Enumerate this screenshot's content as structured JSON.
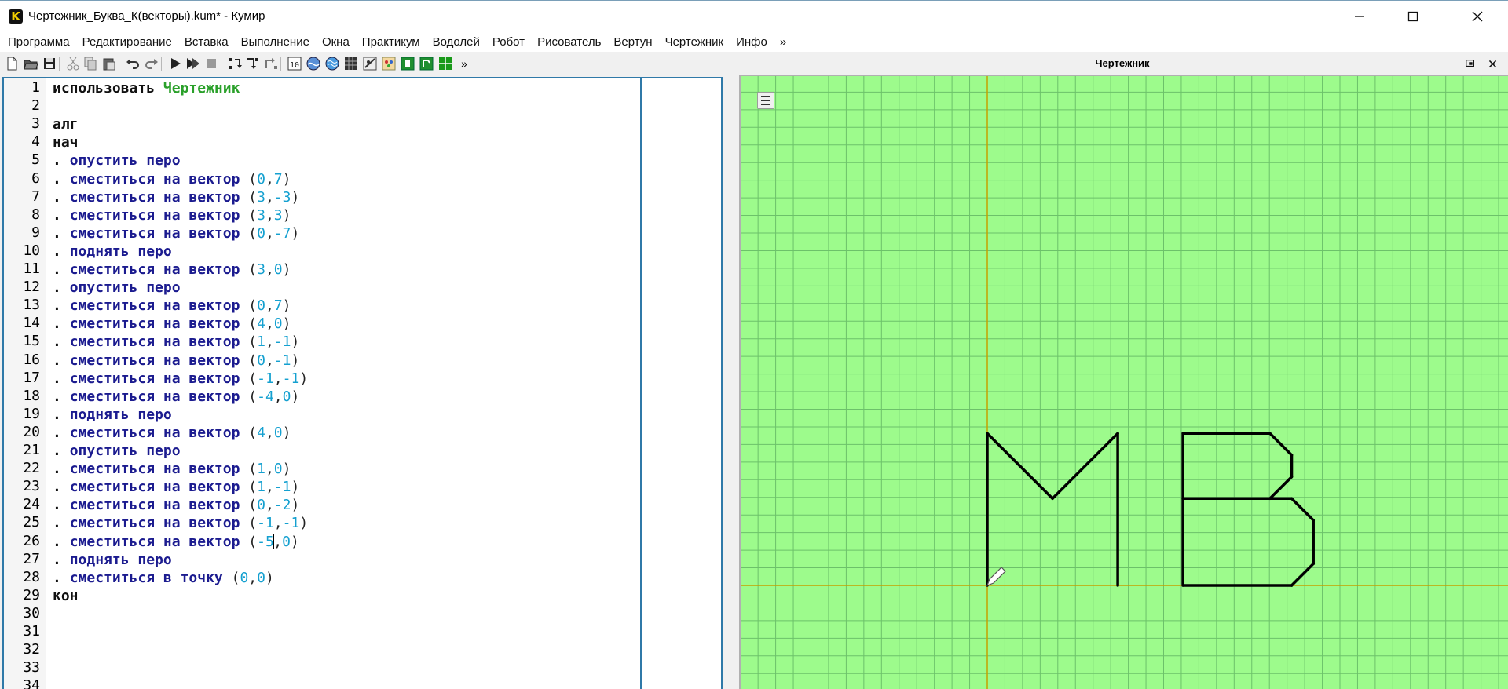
{
  "window": {
    "title": "Чертежник_Буква_К(векторы).kum* - Кумир",
    "app_icon_letter": "K",
    "controls": [
      "minimize-icon",
      "maximize-icon",
      "close-icon"
    ]
  },
  "menu": {
    "items": [
      "Программа",
      "Редактирование",
      "Вставка",
      "Выполнение",
      "Окна",
      "Практикум",
      "Водолей",
      "Робот",
      "Рисователь",
      "Вертун",
      "Чертежник",
      "Инфо",
      "»"
    ]
  },
  "toolbar": {
    "buttons": [
      "new-file-icon",
      "open-folder-icon",
      "save-icon",
      "cut-icon",
      "copy-icon",
      "paste-icon",
      "undo-icon",
      "redo-icon",
      "run-icon",
      "run-steps-icon",
      "stop-icon",
      "step-over-icon",
      "step-into-icon",
      "step-out-icon",
      "counter-icon",
      "water-icon",
      "world-icon",
      "grid-icon",
      "robot-icon",
      "painter-icon",
      "vertun-icon",
      "drawer-icon",
      "grid-green-icon"
    ],
    "overflow_label": "»"
  },
  "editor": {
    "lines": [
      {
        "n": "1",
        "parts": [
          {
            "t": "использовать ",
            "c": "kw-black"
          },
          {
            "t": "Чертежник",
            "c": "kw-green"
          }
        ]
      },
      {
        "n": "2",
        "parts": []
      },
      {
        "n": "3",
        "parts": [
          {
            "t": "алг",
            "c": "kw-black"
          }
        ]
      },
      {
        "n": "4",
        "parts": [
          {
            "t": "нач",
            "c": "kw-black"
          }
        ]
      },
      {
        "n": "5",
        "parts": [
          {
            "t": ". ",
            "c": "kw-black"
          },
          {
            "t": "опустить перо",
            "c": "kw-blue"
          }
        ]
      },
      {
        "n": "6",
        "parts": [
          {
            "t": ". ",
            "c": "kw-black"
          },
          {
            "t": "сместиться на вектор ",
            "c": "kw-blue"
          },
          {
            "t": "(",
            "c": "plain"
          },
          {
            "t": "0",
            "c": "num"
          },
          {
            "t": ",",
            "c": "plain"
          },
          {
            "t": "7",
            "c": "num"
          },
          {
            "t": ")",
            "c": "plain"
          }
        ]
      },
      {
        "n": "7",
        "parts": [
          {
            "t": ". ",
            "c": "kw-black"
          },
          {
            "t": "сместиться на вектор ",
            "c": "kw-blue"
          },
          {
            "t": "(",
            "c": "plain"
          },
          {
            "t": "3",
            "c": "num"
          },
          {
            "t": ",",
            "c": "plain"
          },
          {
            "t": "-3",
            "c": "num"
          },
          {
            "t": ")",
            "c": "plain"
          }
        ]
      },
      {
        "n": "8",
        "parts": [
          {
            "t": ". ",
            "c": "kw-black"
          },
          {
            "t": "сместиться на вектор ",
            "c": "kw-blue"
          },
          {
            "t": "(",
            "c": "plain"
          },
          {
            "t": "3",
            "c": "num"
          },
          {
            "t": ",",
            "c": "plain"
          },
          {
            "t": "3",
            "c": "num"
          },
          {
            "t": ")",
            "c": "plain"
          }
        ]
      },
      {
        "n": "9",
        "parts": [
          {
            "t": ". ",
            "c": "kw-black"
          },
          {
            "t": "сместиться на вектор ",
            "c": "kw-blue"
          },
          {
            "t": "(",
            "c": "plain"
          },
          {
            "t": "0",
            "c": "num"
          },
          {
            "t": ",",
            "c": "plain"
          },
          {
            "t": "-7",
            "c": "num"
          },
          {
            "t": ")",
            "c": "plain"
          }
        ]
      },
      {
        "n": "10",
        "parts": [
          {
            "t": ". ",
            "c": "kw-black"
          },
          {
            "t": "поднять перо",
            "c": "kw-blue"
          }
        ]
      },
      {
        "n": "11",
        "parts": [
          {
            "t": ". ",
            "c": "kw-black"
          },
          {
            "t": "сместиться на вектор ",
            "c": "kw-blue"
          },
          {
            "t": "(",
            "c": "plain"
          },
          {
            "t": "3",
            "c": "num"
          },
          {
            "t": ",",
            "c": "plain"
          },
          {
            "t": "0",
            "c": "num"
          },
          {
            "t": ")",
            "c": "plain"
          }
        ]
      },
      {
        "n": "12",
        "parts": [
          {
            "t": ". ",
            "c": "kw-black"
          },
          {
            "t": "опустить перо",
            "c": "kw-blue"
          }
        ]
      },
      {
        "n": "13",
        "parts": [
          {
            "t": ". ",
            "c": "kw-black"
          },
          {
            "t": "сместиться на вектор ",
            "c": "kw-blue"
          },
          {
            "t": "(",
            "c": "plain"
          },
          {
            "t": "0",
            "c": "num"
          },
          {
            "t": ",",
            "c": "plain"
          },
          {
            "t": "7",
            "c": "num"
          },
          {
            "t": ")",
            "c": "plain"
          }
        ]
      },
      {
        "n": "14",
        "parts": [
          {
            "t": ". ",
            "c": "kw-black"
          },
          {
            "t": "сместиться на вектор ",
            "c": "kw-blue"
          },
          {
            "t": "(",
            "c": "plain"
          },
          {
            "t": "4",
            "c": "num"
          },
          {
            "t": ",",
            "c": "plain"
          },
          {
            "t": "0",
            "c": "num"
          },
          {
            "t": ")",
            "c": "plain"
          }
        ]
      },
      {
        "n": "15",
        "parts": [
          {
            "t": ". ",
            "c": "kw-black"
          },
          {
            "t": "сместиться на вектор ",
            "c": "kw-blue"
          },
          {
            "t": "(",
            "c": "plain"
          },
          {
            "t": "1",
            "c": "num"
          },
          {
            "t": ",",
            "c": "plain"
          },
          {
            "t": "-1",
            "c": "num"
          },
          {
            "t": ")",
            "c": "plain"
          }
        ]
      },
      {
        "n": "16",
        "parts": [
          {
            "t": ". ",
            "c": "kw-black"
          },
          {
            "t": "сместиться на вектор ",
            "c": "kw-blue"
          },
          {
            "t": "(",
            "c": "plain"
          },
          {
            "t": "0",
            "c": "num"
          },
          {
            "t": ",",
            "c": "plain"
          },
          {
            "t": "-1",
            "c": "num"
          },
          {
            "t": ")",
            "c": "plain"
          }
        ]
      },
      {
        "n": "17",
        "parts": [
          {
            "t": ". ",
            "c": "kw-black"
          },
          {
            "t": "сместиться на вектор ",
            "c": "kw-blue"
          },
          {
            "t": "(",
            "c": "plain"
          },
          {
            "t": "-1",
            "c": "num"
          },
          {
            "t": ",",
            "c": "plain"
          },
          {
            "t": "-1",
            "c": "num"
          },
          {
            "t": ")",
            "c": "plain"
          }
        ]
      },
      {
        "n": "18",
        "parts": [
          {
            "t": ". ",
            "c": "kw-black"
          },
          {
            "t": "сместиться на вектор ",
            "c": "kw-blue"
          },
          {
            "t": "(",
            "c": "plain"
          },
          {
            "t": "-4",
            "c": "num"
          },
          {
            "t": ",",
            "c": "plain"
          },
          {
            "t": "0",
            "c": "num"
          },
          {
            "t": ")",
            "c": "plain"
          }
        ]
      },
      {
        "n": "19",
        "parts": [
          {
            "t": ". ",
            "c": "kw-black"
          },
          {
            "t": "поднять перо",
            "c": "kw-blue"
          }
        ]
      },
      {
        "n": "20",
        "parts": [
          {
            "t": ". ",
            "c": "kw-black"
          },
          {
            "t": "сместиться на вектор ",
            "c": "kw-blue"
          },
          {
            "t": "(",
            "c": "plain"
          },
          {
            "t": "4",
            "c": "num"
          },
          {
            "t": ",",
            "c": "plain"
          },
          {
            "t": "0",
            "c": "num"
          },
          {
            "t": ")",
            "c": "plain"
          }
        ]
      },
      {
        "n": "21",
        "parts": [
          {
            "t": ". ",
            "c": "kw-black"
          },
          {
            "t": "опустить перо",
            "c": "kw-blue"
          }
        ]
      },
      {
        "n": "22",
        "parts": [
          {
            "t": ". ",
            "c": "kw-black"
          },
          {
            "t": "сместиться на вектор ",
            "c": "kw-blue"
          },
          {
            "t": "(",
            "c": "plain"
          },
          {
            "t": "1",
            "c": "num"
          },
          {
            "t": ",",
            "c": "plain"
          },
          {
            "t": "0",
            "c": "num"
          },
          {
            "t": ")",
            "c": "plain"
          }
        ]
      },
      {
        "n": "23",
        "parts": [
          {
            "t": ". ",
            "c": "kw-black"
          },
          {
            "t": "сместиться на вектор ",
            "c": "kw-blue"
          },
          {
            "t": "(",
            "c": "plain"
          },
          {
            "t": "1",
            "c": "num"
          },
          {
            "t": ",",
            "c": "plain"
          },
          {
            "t": "-1",
            "c": "num"
          },
          {
            "t": ")",
            "c": "plain"
          }
        ]
      },
      {
        "n": "24",
        "parts": [
          {
            "t": ". ",
            "c": "kw-black"
          },
          {
            "t": "сместиться на вектор ",
            "c": "kw-blue"
          },
          {
            "t": "(",
            "c": "plain"
          },
          {
            "t": "0",
            "c": "num"
          },
          {
            "t": ",",
            "c": "plain"
          },
          {
            "t": "-2",
            "c": "num"
          },
          {
            "t": ")",
            "c": "plain"
          }
        ]
      },
      {
        "n": "25",
        "parts": [
          {
            "t": ". ",
            "c": "kw-black"
          },
          {
            "t": "сместиться на вектор ",
            "c": "kw-blue"
          },
          {
            "t": "(",
            "c": "plain"
          },
          {
            "t": "-1",
            "c": "num"
          },
          {
            "t": ",",
            "c": "plain"
          },
          {
            "t": "-1",
            "c": "num"
          },
          {
            "t": ")",
            "c": "plain"
          }
        ]
      },
      {
        "n": "26",
        "parts": [
          {
            "t": ". ",
            "c": "kw-black"
          },
          {
            "t": "сместиться на вектор ",
            "c": "kw-blue"
          },
          {
            "t": "(",
            "c": "plain"
          },
          {
            "t": "-5",
            "c": "num"
          },
          {
            "cursor": true
          },
          {
            "t": ",",
            "c": "plain"
          },
          {
            "t": "0",
            "c": "num"
          },
          {
            "t": ")",
            "c": "plain"
          }
        ]
      },
      {
        "n": "27",
        "parts": [
          {
            "t": ". ",
            "c": "kw-black"
          },
          {
            "t": "поднять перо",
            "c": "kw-blue"
          }
        ]
      },
      {
        "n": "28",
        "parts": [
          {
            "t": ". ",
            "c": "kw-black"
          },
          {
            "t": "сместиться в точку ",
            "c": "kw-blue"
          },
          {
            "t": "(",
            "c": "plain"
          },
          {
            "t": "0",
            "c": "num"
          },
          {
            "t": ",",
            "c": "plain"
          },
          {
            "t": "0",
            "c": "num"
          },
          {
            "t": ")",
            "c": "plain"
          }
        ]
      },
      {
        "n": "29",
        "parts": [
          {
            "t": "кон",
            "c": "kw-black"
          }
        ]
      },
      {
        "n": "30",
        "parts": []
      },
      {
        "n": "31",
        "parts": []
      },
      {
        "n": "32",
        "parts": []
      },
      {
        "n": "33",
        "parts": []
      },
      {
        "n": "34",
        "parts": []
      }
    ]
  },
  "drawer": {
    "title": "Чертежник",
    "background_color": "#9dfb8c",
    "grid_color": "#6cc16a",
    "axis_color": "#c4a100",
    "pen_color": "#000000",
    "path_world": [
      {
        "from": [
          0,
          0
        ],
        "to": [
          0,
          7
        ]
      },
      {
        "from": [
          0,
          7
        ],
        "to": [
          3,
          4
        ]
      },
      {
        "from": [
          3,
          4
        ],
        "to": [
          6,
          7
        ]
      },
      {
        "from": [
          6,
          7
        ],
        "to": [
          6,
          0
        ]
      },
      {
        "from": [
          9,
          0
        ],
        "to": [
          9,
          7
        ]
      },
      {
        "from": [
          9,
          7
        ],
        "to": [
          13,
          7
        ]
      },
      {
        "from": [
          13,
          7
        ],
        "to": [
          14,
          6
        ]
      },
      {
        "from": [
          14,
          6
        ],
        "to": [
          14,
          5
        ]
      },
      {
        "from": [
          14,
          5
        ],
        "to": [
          13,
          4
        ]
      },
      {
        "from": [
          13,
          4
        ],
        "to": [
          9,
          4
        ]
      },
      {
        "from": [
          9,
          4
        ],
        "to": [
          14,
          4
        ]
      },
      {
        "from": [
          14,
          4
        ],
        "to": [
          15,
          3
        ]
      },
      {
        "from": [
          15,
          3
        ],
        "to": [
          15,
          1
        ]
      },
      {
        "from": [
          15,
          1
        ],
        "to": [
          14,
          0
        ]
      },
      {
        "from": [
          14,
          0
        ],
        "to": [
          9,
          0
        ]
      }
    ],
    "pen_position": [
      0,
      0
    ],
    "controls": [
      "restore-icon",
      "close-icon"
    ]
  }
}
